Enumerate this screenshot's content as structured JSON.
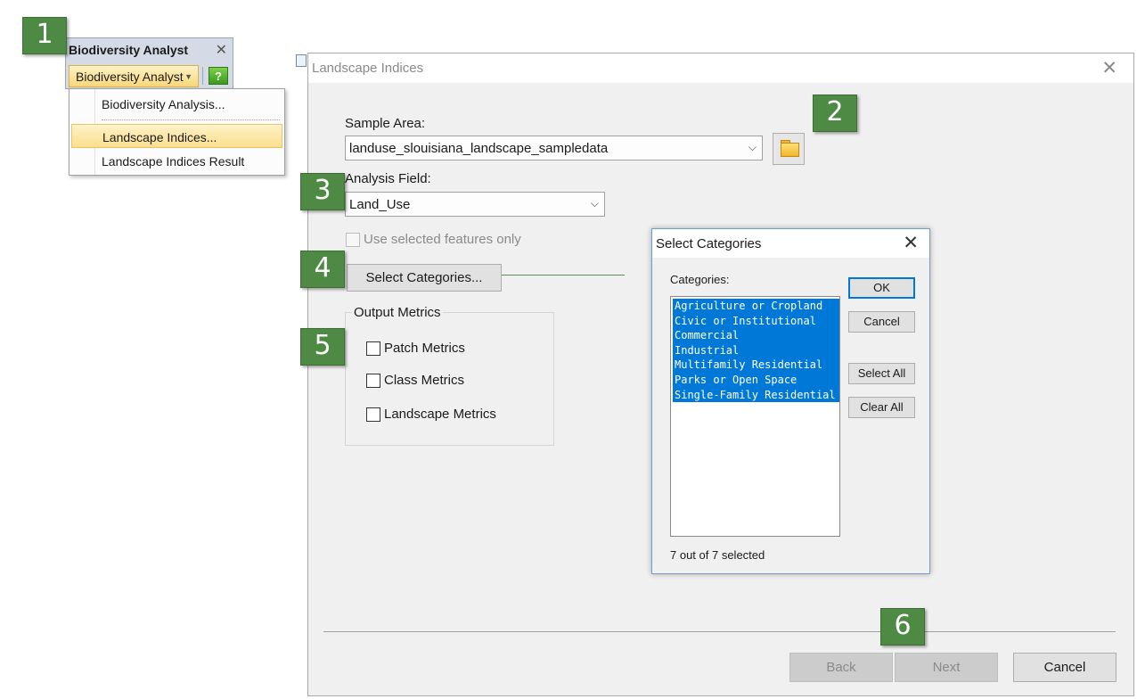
{
  "markers": [
    "1",
    "2",
    "3",
    "4",
    "5",
    "6"
  ],
  "toolbar": {
    "title": "Biodiversity Analyst",
    "close": "✕",
    "dropdown_label": "Biodiversity Analyst",
    "dropdown_caret": "▼",
    "help": "?",
    "menu": [
      {
        "label": "Biodiversity Analysis..."
      },
      {
        "label": "Landscape Indices..."
      },
      {
        "label": "Landscape Indices Result"
      }
    ]
  },
  "dialog": {
    "title": "Landscape Indices",
    "close": "✕",
    "sample_area_label": "Sample Area:",
    "sample_area_value": "landuse_slouisiana_landscape_sampledata",
    "analysis_field_label": "Analysis Field:",
    "analysis_field_value": "Land_Use",
    "combo_arrow": "⌵",
    "use_selected_label": "Use selected features only",
    "select_categories_button": "Select Categories...",
    "output_metrics": {
      "legend": "Output Metrics",
      "items": [
        "Patch Metrics",
        "Class Metrics",
        "Landscape Metrics"
      ]
    },
    "back_button": "Back",
    "next_button": "Next",
    "cancel_button": "Cancel"
  },
  "select_categories": {
    "title": "Select Categories",
    "close": "✕",
    "categories_label": "Categories:",
    "items": [
      "Agriculture or Cropland",
      "Civic or Institutional",
      "Commercial",
      "Industrial",
      "Multifamily Residential",
      "Parks or Open Space",
      "Single-Family Residential"
    ],
    "ok": "OK",
    "cancel": "Cancel",
    "select_all": "Select All",
    "clear_all": "Clear All",
    "status": "7 out of 7 selected"
  },
  "colors": {
    "marker": "#4f8a45",
    "selection": "#0078d7",
    "menu_highlight": "#fbdf8e"
  }
}
